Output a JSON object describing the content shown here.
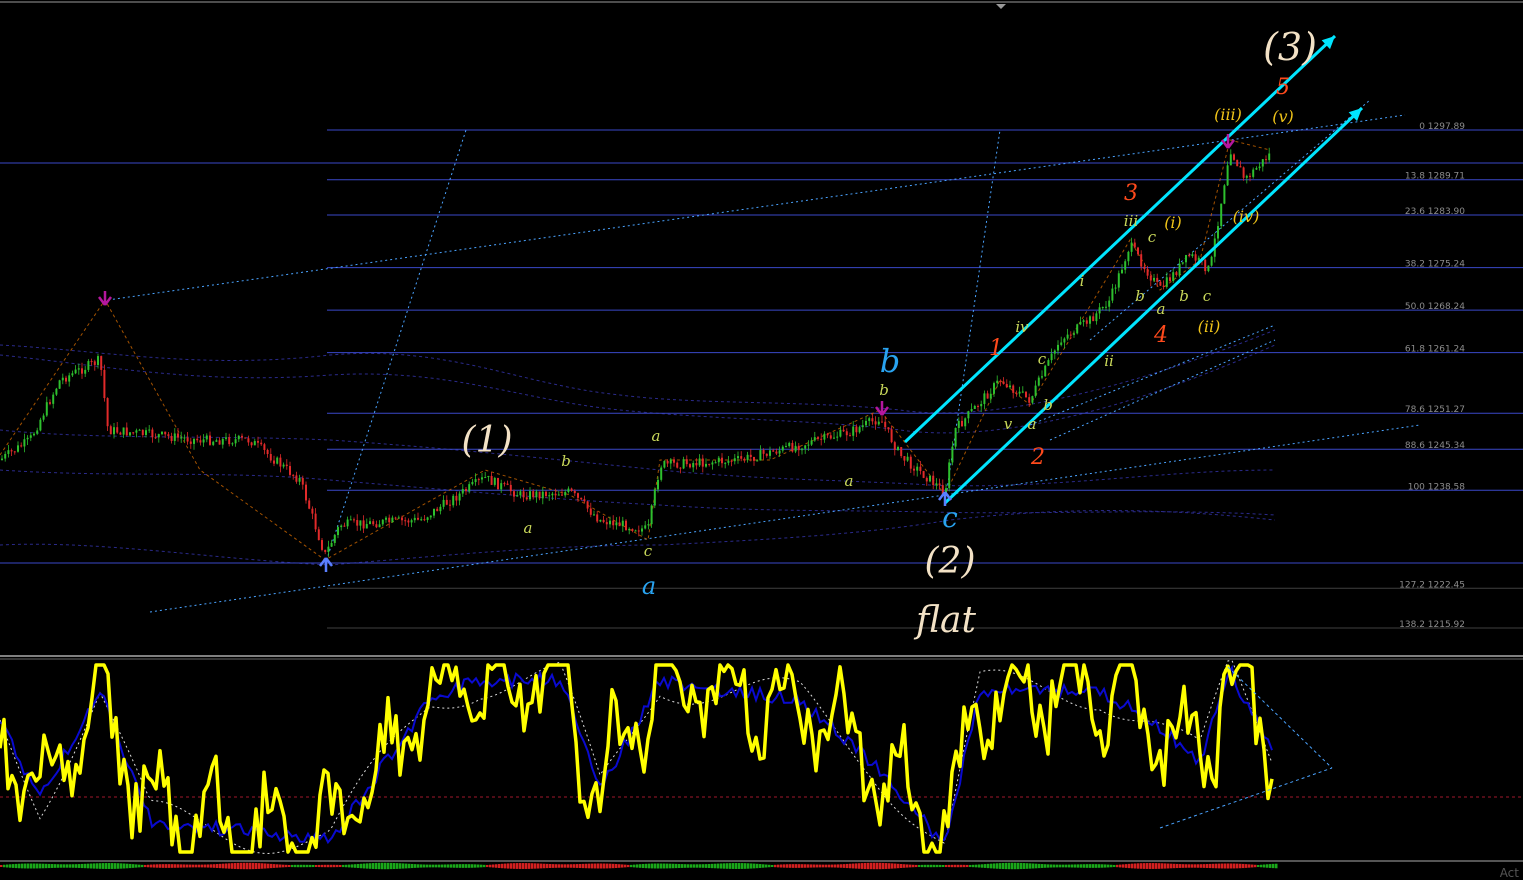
{
  "colors": {
    "background": "#000000",
    "fib_line": "#3a48c8",
    "bull_candle": "#2ec02e",
    "bear_candle": "#e12a2a",
    "oscillator_main": "#ffff00",
    "oscillator_signal": "#0a0ad0",
    "channel_arrow": "#00e5ff",
    "trend_dotted": "#4aa3ff",
    "wave_primary": "#f3e2c6",
    "wave_minor_blue": "#29a3f0",
    "wave_red": "#ff4a1c",
    "wave_yellow": "#f0c419",
    "wave_small": "#c9d85a"
  },
  "watermark": "Act",
  "chart_data": [
    {
      "type": "candlestick",
      "fib_levels": [
        {
          "label": "0 1297.89",
          "price": 1297.89
        },
        {
          "label": "13.8 1289.71",
          "price": 1289.71
        },
        {
          "label": "23.6 1283.90",
          "price": 1283.9
        },
        {
          "label": "38.2 1275.24",
          "price": 1275.24
        },
        {
          "label": "50.0 1268.24",
          "price": 1268.24
        },
        {
          "label": "61.8 1261.24",
          "price": 1261.24
        },
        {
          "label": "78.6 1251.27",
          "price": 1251.27
        },
        {
          "label": "88.6 1245.34",
          "price": 1245.34
        },
        {
          "label": "100 1238.58",
          "price": 1238.58
        },
        {
          "label": "127.2 1222.45",
          "price": 1222.45
        },
        {
          "label": "138.2 1215.92",
          "price": 1215.92
        }
      ],
      "wave_labels": {
        "primary": [
          "(1)",
          "(2)",
          "(3)",
          "flat"
        ],
        "minor_blue": [
          "a",
          "b",
          "c"
        ],
        "red": [
          "1",
          "2",
          "3",
          "4",
          "5"
        ],
        "yellow": [
          "(i)",
          "(ii)",
          "(iii)",
          "(iv)",
          "(v)"
        ],
        "small": [
          "a",
          "b",
          "a",
          "c",
          "a",
          "b",
          "c",
          "b",
          "i",
          "ii",
          "iii",
          "iv",
          "v",
          "a",
          "b",
          "c",
          "a",
          "b",
          "c"
        ]
      }
    },
    {
      "type": "line",
      "series": [],
      "annotations": [
        "triangle"
      ]
    }
  ]
}
